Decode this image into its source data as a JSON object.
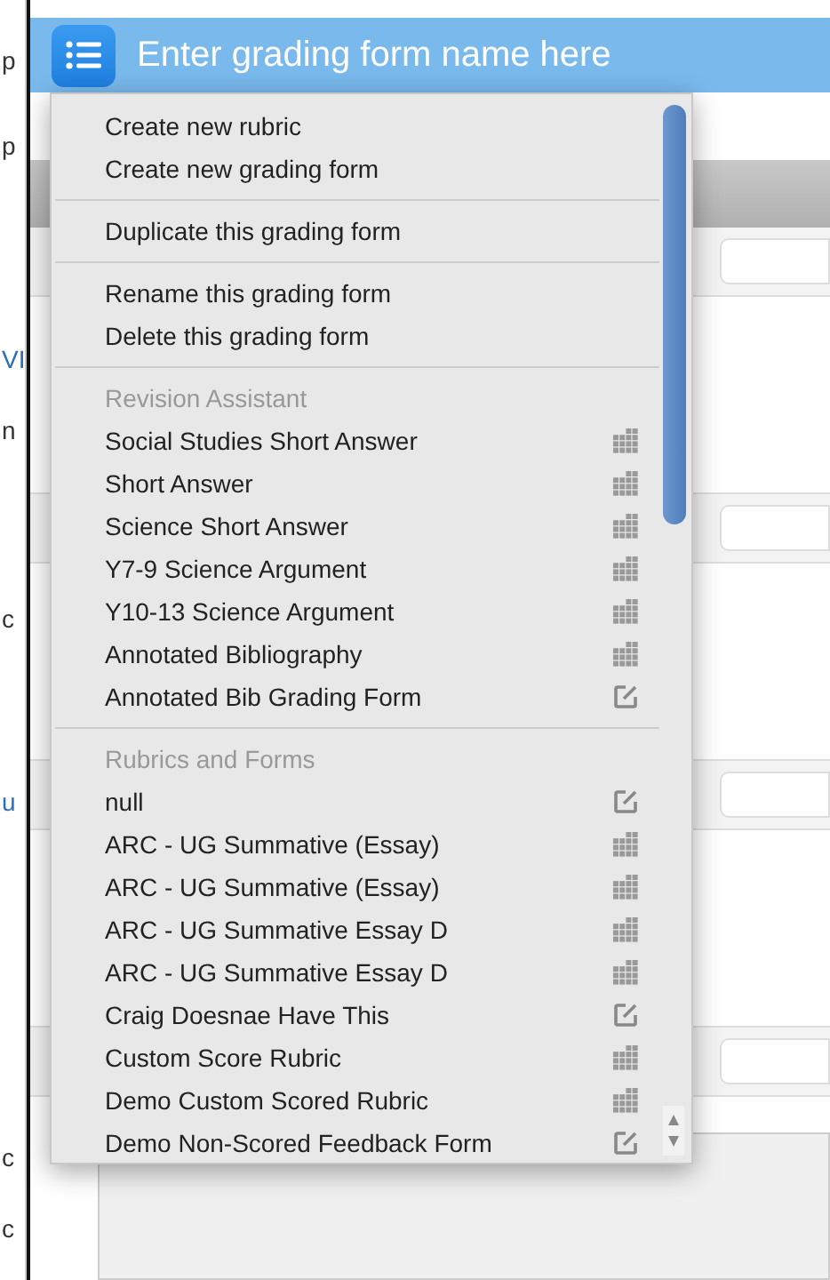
{
  "edge_fragments": [
    {
      "text": "p",
      "kind": "plain"
    },
    {
      "text": "p",
      "kind": "plain"
    },
    {
      "text": "VI",
      "kind": "link"
    },
    {
      "text": "n",
      "kind": "plain"
    },
    {
      "text": "c",
      "kind": "plain"
    },
    {
      "text": "u",
      "kind": "link"
    },
    {
      "text": "c",
      "kind": "plain"
    },
    {
      "text": "c",
      "kind": "plain"
    }
  ],
  "header": {
    "title": "Enter grading form name here"
  },
  "menu": {
    "sections": [
      {
        "items": [
          {
            "label": "Create new rubric",
            "kind": "action"
          },
          {
            "label": "Create new grading form",
            "kind": "action"
          }
        ]
      },
      {
        "items": [
          {
            "label": "Duplicate this grading form",
            "kind": "action"
          }
        ]
      },
      {
        "items": [
          {
            "label": "Rename this grading form",
            "kind": "action"
          },
          {
            "label": "Delete this grading form",
            "kind": "action"
          }
        ]
      },
      {
        "heading": "Revision Assistant",
        "items": [
          {
            "label": "Social Studies Short Answer",
            "kind": "grid"
          },
          {
            "label": "Short Answer",
            "kind": "grid"
          },
          {
            "label": "Science Short Answer",
            "kind": "grid"
          },
          {
            "label": "Y7-9 Science Argument",
            "kind": "grid"
          },
          {
            "label": "Y10-13 Science Argument",
            "kind": "grid"
          },
          {
            "label": "Annotated Bibliography",
            "kind": "grid"
          },
          {
            "label": "Annotated Bib Grading Form",
            "kind": "edit"
          }
        ]
      },
      {
        "heading": "Rubrics and Forms",
        "items": [
          {
            "label": "null",
            "kind": "edit"
          },
          {
            "label": "ARC - UG Summative (Essay)",
            "kind": "grid"
          },
          {
            "label": "ARC - UG Summative (Essay)",
            "kind": "grid"
          },
          {
            "label": "ARC - UG Summative Essay D",
            "kind": "grid"
          },
          {
            "label": "ARC - UG Summative Essay D",
            "kind": "grid"
          },
          {
            "label": "Craig Doesnae Have This",
            "kind": "edit"
          },
          {
            "label": "Custom Score Rubric",
            "kind": "grid"
          },
          {
            "label": "Demo Custom Scored Rubric",
            "kind": "grid"
          },
          {
            "label": "Demo Non-Scored Feedback Form",
            "kind": "edit"
          }
        ]
      }
    ]
  }
}
